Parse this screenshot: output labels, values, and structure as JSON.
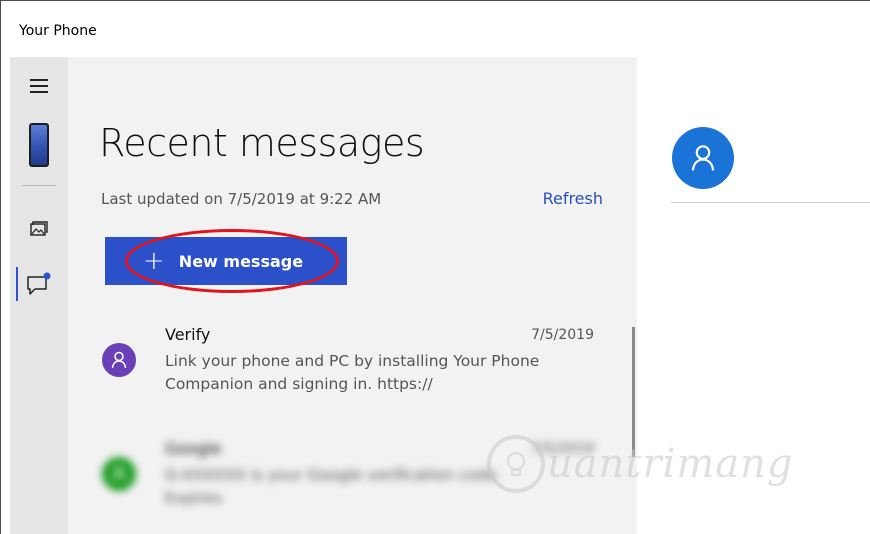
{
  "app": {
    "title": "Your Phone"
  },
  "rail": {
    "items": [
      {
        "icon": "hamburger-icon"
      },
      {
        "icon": "phone-icon"
      },
      {
        "icon": "photos-icon"
      },
      {
        "icon": "messages-icon",
        "active": true
      }
    ],
    "accent": "#2b54d1"
  },
  "messages": {
    "title": "Recent messages",
    "last_updated": "Last updated on 7/5/2019 at 9:22 AM",
    "refresh_label": "Refresh",
    "new_message_label": "New message",
    "new_message_icon": "+",
    "list": [
      {
        "sender": "Verify",
        "date": "7/5/2019",
        "preview": "Link your phone and PC by installing Your Phone Companion and signing in. https://",
        "avatar_color": "#6b3fb8"
      },
      {
        "sender": "Google",
        "date": "7/5/2019",
        "preview": "G-XXXXXX is your Google verification code. Expires",
        "avatar_color": "#1b9b22"
      }
    ]
  },
  "detail": {
    "avatar_color": "#1a73d6"
  },
  "watermark": {
    "text": "uantrimang"
  }
}
